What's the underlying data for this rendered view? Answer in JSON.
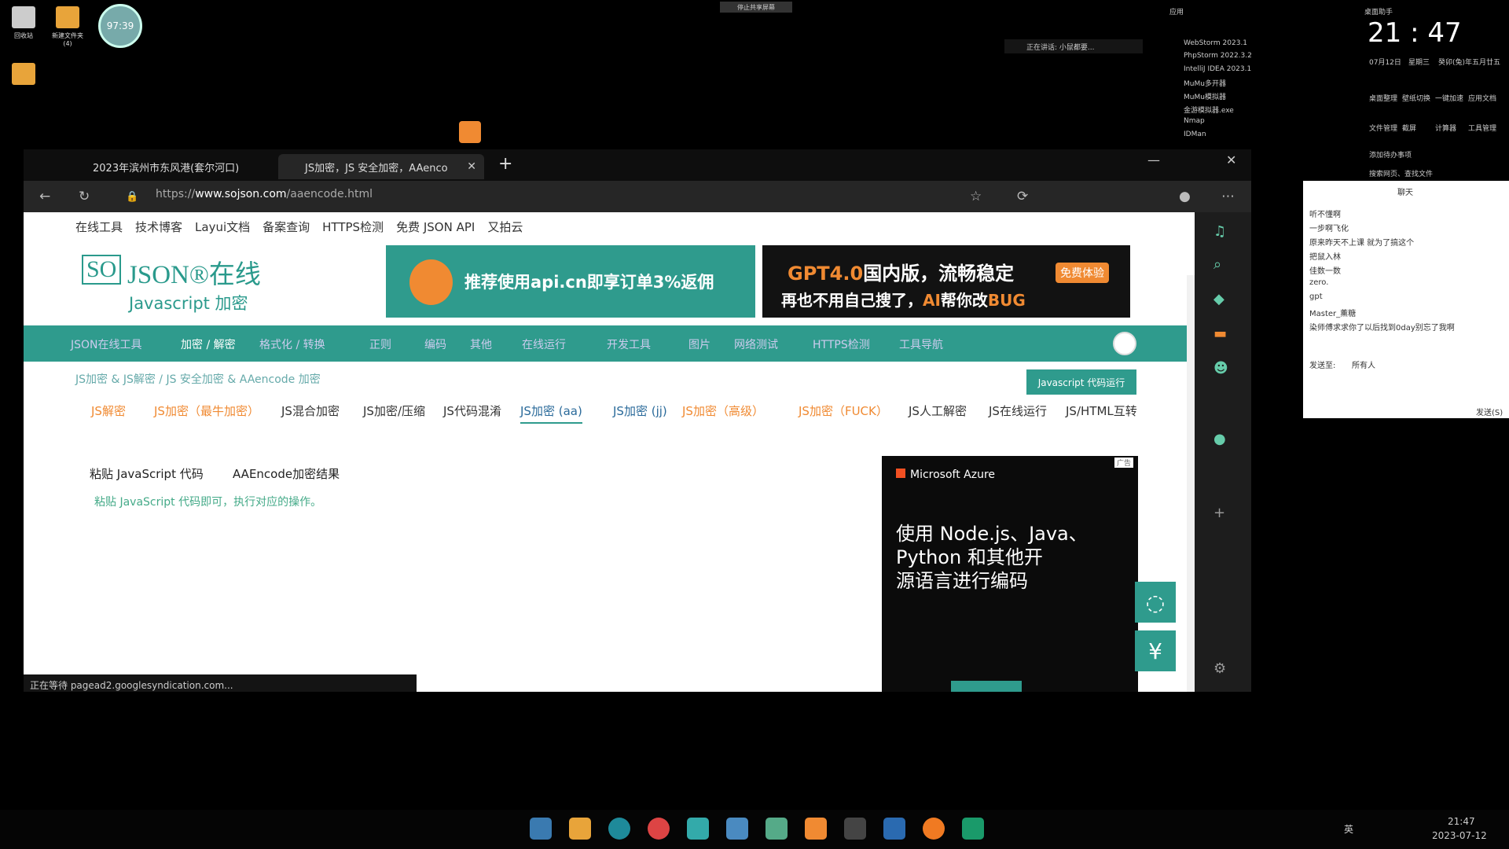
{
  "desktop": {
    "icon_recycle": "回收站",
    "icon_folder": "新建文件夹",
    "icon_folder_count": "(4)",
    "clock_badge": "97:39",
    "top_banner": "停止共享屏幕"
  },
  "apps_list": {
    "header": "应用",
    "items": [
      "WebStorm 2023.1",
      "PhpStorm 2022.3.2",
      "IntelliJ IDEA 2023.1",
      "MuMu多开器",
      "MuMu模拟器",
      "金游模拟器.exe",
      "Nmap",
      "IDMan"
    ],
    "recording": "正在讲话: 小鼠都要..."
  },
  "clock_widget": {
    "title": "桌面助手",
    "time": "21 : 47",
    "date": "07月12日",
    "weekday": "星期三",
    "lunar": "癸卯(兔)年五月廿五",
    "labels": [
      "桌面整理",
      "壁纸切换",
      "一键加速",
      "应用文档",
      "文件管理",
      "截屏",
      "计算器",
      "工具管理"
    ],
    "search": "搜索网页、查找文件",
    "new_task": "添加待办事项"
  },
  "browser": {
    "tab1": "2023年滨州市东风港(套尔河口)",
    "tab2": "JS加密，JS 安全加密，AAenco",
    "url_prefix": "https://",
    "url_domain": "www.sojson.com",
    "url_path": "/aaencode.html",
    "status": "正在等待 pagead2.googlesyndication.com..."
  },
  "site": {
    "topnav": [
      "在线工具",
      "技术博客",
      "Layui文档",
      "备案查询",
      "HTTPS检测",
      "免费 JSON API",
      "又拍云"
    ],
    "logo_so": "SO",
    "logo_json": "JSON®在线",
    "logo_sub": "Javascript 加密",
    "ad1": "推荐使用api.cn即享订单3%返佣",
    "ad2_line1a": "GPT4.0",
    "ad2_line1b": "国内版，流畅稳定",
    "ad2_line2a": "再也不用自己搜了，",
    "ad2_line2b": "AI",
    "ad2_line2c": "帮你改",
    "ad2_line2d": "BUG",
    "ad2_btn": "免费体验",
    "menu": [
      "JSON在线工具",
      "加密 / 解密",
      "格式化 / 转换",
      "正则",
      "编码",
      "其他",
      "在线运行",
      "开发工具",
      "图片",
      "网络测试",
      "HTTPS检测",
      "工具导航"
    ],
    "breadcrumb": "JS加密 & JS解密  /  JS 安全加密 & AAencode 加密",
    "run_button": "Javascript 代码运行",
    "subtabs": [
      "JS解密",
      "JS加密（最牛加密）",
      "JS混合加密",
      "JS加密/压缩",
      "JS代码混淆",
      "JS加密 (aa)",
      "JS加密 (jj)",
      "JS加密（高级）",
      "JS加密（FUCK）",
      "JS人工解密",
      "JS在线运行",
      "JS/HTML互转"
    ],
    "label_paste": "粘贴 JavaScript 代码",
    "label_result": "AAEncode加密结果",
    "hint": "粘贴 JavaScript 代码即可，执行对应的操作。",
    "azure_brand": "Microsoft Azure",
    "azure_text": [
      "使用 Node.js、Java、",
      "Python 和其他开",
      "源语言进行编码"
    ],
    "ad_label": "广告"
  },
  "chat": {
    "title": "聊天",
    "messages": [
      "听不懂啊",
      "一步啊飞化",
      "原来昨天不上课 就为了搞这个",
      "把鼠入林",
      "佳数一数",
      "zero.",
      "gpt",
      "Master_薰糖",
      "染师傅求求你了以后找到0day别忘了我啊"
    ],
    "send_to": "发送至:",
    "recipient": "所有人",
    "send": "发送(S)"
  },
  "tray": {
    "ime": "英",
    "time": "21:47",
    "date": "2023-07-12"
  }
}
